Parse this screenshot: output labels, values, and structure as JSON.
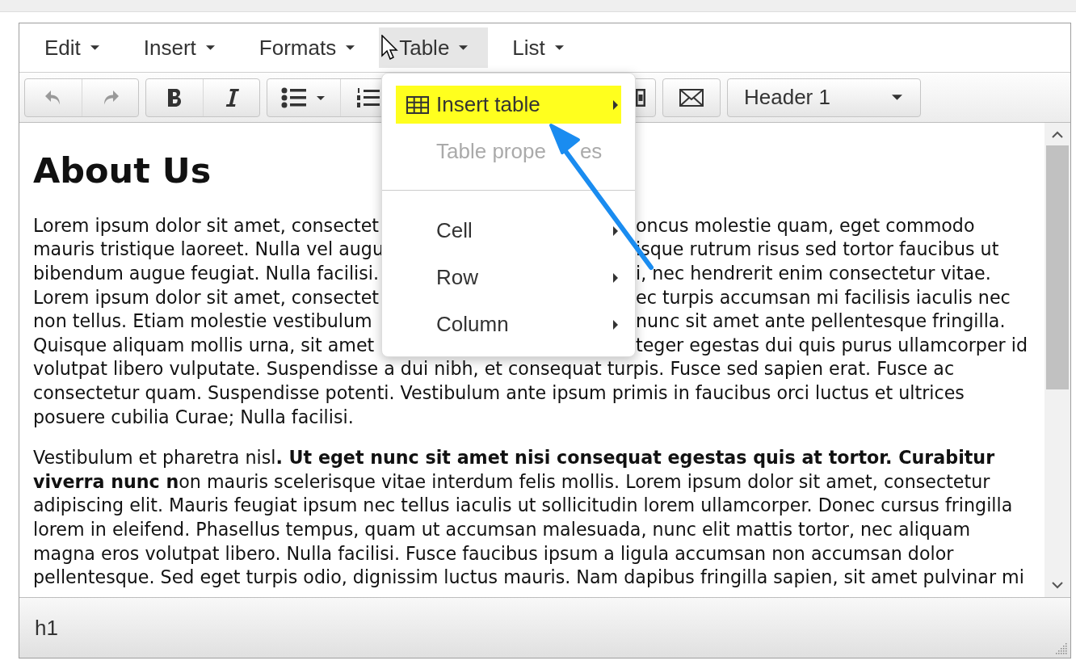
{
  "menubar": [
    {
      "label": "Edit",
      "selected": false
    },
    {
      "label": "Insert",
      "selected": false
    },
    {
      "label": "Formats",
      "selected": false
    },
    {
      "label": "Table",
      "selected": true
    },
    {
      "label": "List",
      "selected": false
    }
  ],
  "toolbar": {
    "groups": [
      [
        {
          "kind": "undo",
          "disabled": true
        },
        {
          "kind": "redo",
          "disabled": true
        }
      ],
      [
        {
          "kind": "bold",
          "disabled": false
        },
        {
          "kind": "italic",
          "disabled": false
        }
      ],
      [
        {
          "kind": "bullet-list",
          "disabled": false
        },
        {
          "kind": "numbered-list",
          "disabled": false
        }
      ],
      [
        {
          "kind": "picture",
          "disabled": false
        }
      ],
      [
        {
          "kind": "email",
          "disabled": false
        }
      ]
    ],
    "format": {
      "value": "Header 1"
    }
  },
  "dropdown": {
    "items": [
      {
        "kind": "icon-item",
        "label": "Insert table",
        "selected": true,
        "disabled": false,
        "submenu": true
      },
      {
        "kind": "item",
        "label": "Table prope",
        "label_end": "es",
        "selected": false,
        "disabled": true,
        "submenu": false
      },
      {
        "kind": "divider"
      },
      {
        "kind": "item",
        "label": "Cell",
        "selected": false,
        "disabled": false,
        "submenu": true
      },
      {
        "kind": "item",
        "label": "Row",
        "selected": false,
        "disabled": false,
        "submenu": true
      },
      {
        "kind": "item",
        "label": "Column",
        "selected": false,
        "disabled": false,
        "submenu": true
      }
    ]
  },
  "document": {
    "heading": "About Us",
    "paragraphs": [
      {
        "lines": [
          {
            "left": "Lorem ipsum dolor sit amet, consectet",
            "right": "oncus molestie quam, eget commodo"
          },
          {
            "left": "mauris tristique laoreet. Nulla vel augu",
            "right": "isque rutrum risus sed tortor faucibus ut"
          },
          {
            "left": "bibendum augue feugiat. Nulla facilisi.",
            "right": "i, nec hendrerit enim consectetur vitae."
          },
          {
            "left": "Lorem ipsum dolor sit amet, consectet",
            "right": "ec turpis accumsan mi facilisis iaculis nec"
          },
          {
            "left": "non tellus. Etiam molestie vestibulum",
            "right": "nunc sit amet ante pellentesque fringilla."
          },
          {
            "left": "Quisque aliquam mollis urna, sit amet",
            "right": "teger egestas dui quis purus ullamcorper id"
          },
          {
            "left": "volutpat libero vulputate. Suspendisse a dui nibh, et consequat turpis. Fusce sed sapien erat. Fusce ac"
          },
          {
            "left": "consectetur quam. Suspendisse potenti. Vestibulum ante ipsum primis in faucibus orci luctus et ultrices"
          },
          {
            "left": "posuere cubilia Curae; Nulla facilisi."
          }
        ]
      },
      {
        "lines": [
          {
            "left": "Vestibulum et pharetra nisl**. Ut eget nunc sit amet nisi consequat egestas quis at tortor. Curabitur**"
          },
          {
            "left": "**viverra nunc n**on mauris scelerisque vitae interdum felis mollis. Lorem ipsum dolor sit amet, consectetur"
          },
          {
            "left": "adipiscing elit. Mauris feugiat ipsum nec tellus iaculis ut sollicitudin lorem ullamcorper. Donec cursus fringilla"
          },
          {
            "left": "lorem in eleifend. Phasellus tempus, quam ut accumsan malesuada, nunc elit mattis tortor, nec aliquam"
          },
          {
            "left": "magna eros volutpat libero. Nulla facilisi. Fusce faucibus ipsum a ligula accumsan non accumsan dolor"
          },
          {
            "left": "pellentesque. Sed eget turpis odio, dignissim luctus mauris. Nam dapibus fringilla sapien, sit amet pulvinar mi"
          }
        ]
      }
    ]
  },
  "status_bar": {
    "path": "h1"
  }
}
